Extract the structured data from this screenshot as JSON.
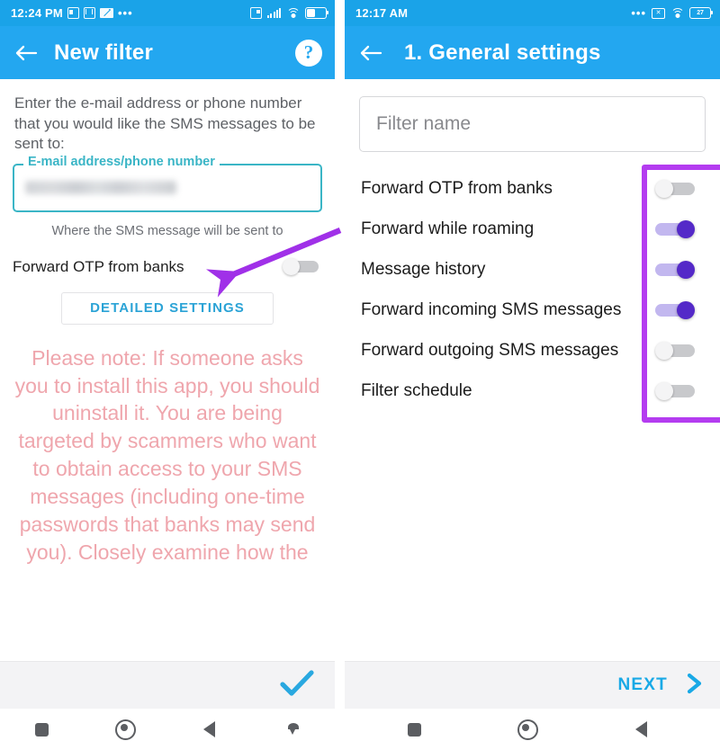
{
  "left_phone": {
    "status_bar": {
      "time": "12:24 PM",
      "icons_left": [
        "screenshot-icon",
        "mx-player-icon",
        "envelope-icon",
        "more-dots-icon"
      ],
      "icons_right": [
        "sim-icon",
        "signal-bars-icon",
        "wifi-icon",
        "battery-icon"
      ]
    },
    "app_bar": {
      "back_icon": "back-arrow-icon",
      "title": "New filter",
      "help_label": "?"
    },
    "intro_text": "Enter the e-mail address or phone number that you would like the SMS messages to be sent to:",
    "field": {
      "label": "E-mail address/phone number",
      "value": "",
      "value_redacted": true,
      "helper": "Where the SMS message will be sent to",
      "border_color": "#3ab5c6"
    },
    "otp_row": {
      "label": "Forward OTP from banks",
      "toggle_on": false
    },
    "detailed_button": "DETAILED SETTINGS",
    "warning_text": "Please note: If someone asks you to install this app, you should uninstall it. You are being targeted by scammers who want to obtain access to your SMS messages (including one-time passwords that banks may send you). Closely examine how the",
    "warning_color": "#efa6ad",
    "action_bar": {
      "confirm_icon": "checkmark-icon",
      "confirm_color": "#29a8e0"
    },
    "nav_bar": [
      "recents-square-icon",
      "home-circle-icon",
      "back-triangle-icon",
      "hide-nav-icon"
    ]
  },
  "right_phone": {
    "status_bar": {
      "time": "12:17 AM",
      "icons_left": [],
      "icons_right": [
        "more-dots-icon",
        "no-sim-icon",
        "wifi-icon",
        "battery-icon"
      ],
      "battery_level": "27"
    },
    "app_bar": {
      "back_icon": "back-arrow-icon",
      "title": "1. General settings"
    },
    "filter_name": {
      "placeholder": "Filter name",
      "value": ""
    },
    "settings": [
      {
        "label": "Forward OTP from banks",
        "on": false
      },
      {
        "label": "Forward while roaming",
        "on": true
      },
      {
        "label": "Message history",
        "on": true
      },
      {
        "label": "Forward incoming SMS messages",
        "on": true
      },
      {
        "label": "Forward outgoing SMS messages",
        "on": false
      },
      {
        "label": "Filter schedule",
        "on": false
      }
    ],
    "action_bar": {
      "next_label": "NEXT",
      "next_icon": "chevron-right-icon",
      "accent_color": "#19a9e6"
    },
    "nav_bar": [
      "recents-square-icon",
      "home-circle-icon",
      "back-triangle-icon"
    ]
  },
  "annotations": {
    "arrow": {
      "name": "purple-arrow-annotation",
      "color": "#a030e8",
      "points_to": "Forward OTP from banks toggle"
    },
    "highlight": {
      "name": "purple-highlight-box",
      "color": "#b43cf0",
      "surrounds": "toggle switches column"
    }
  },
  "theme": {
    "status_bar_blue": "#1aa3e8",
    "app_bar_blue": "#23a7f0",
    "toggle_on_purple": "#5429c8",
    "toggle_track_on": "#c2b7ef",
    "toggle_off_gray": "#c8c9cc"
  }
}
